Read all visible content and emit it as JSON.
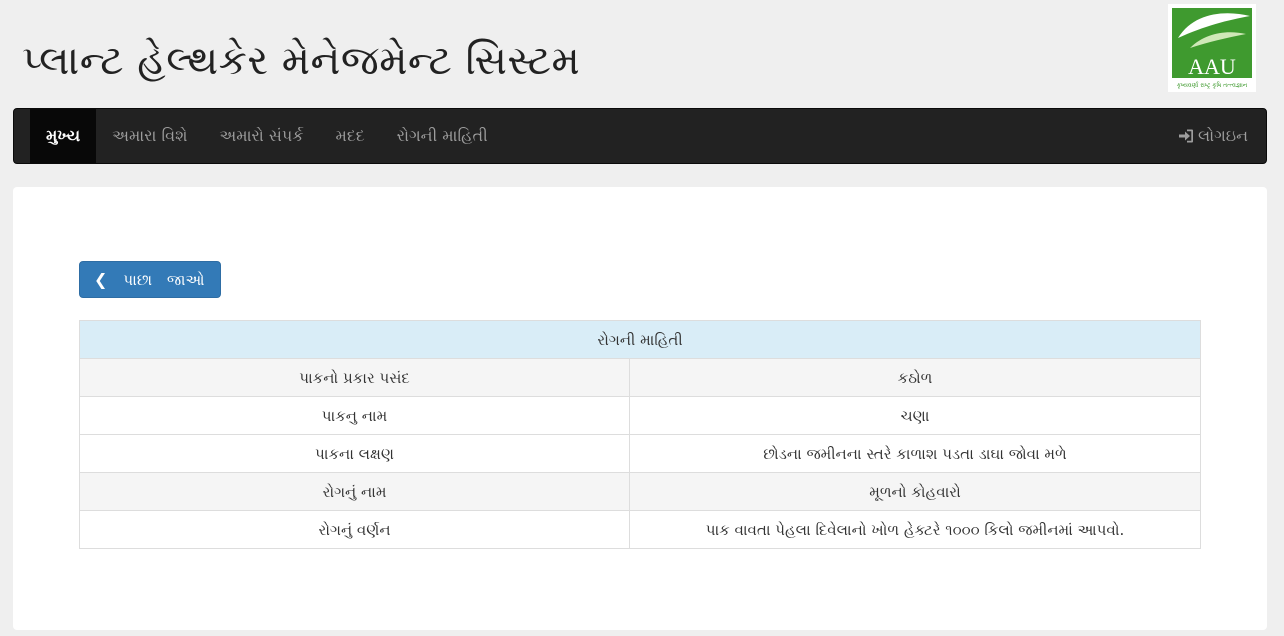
{
  "header": {
    "title": "પ્લાન્ટ હેલ્થકેર મેનેજમેન્ટ સિસ્ટમ",
    "logo": {
      "text": "AAU",
      "tagline": "કૃષ્યવર્ણા રાષ્ટ્ર કૃષિ તત્ત્વજ્ઞાન",
      "icon": "leaf-logo-icon",
      "colors": {
        "green": "#3f9a2f",
        "light": "#8cc63f"
      }
    }
  },
  "navbar": {
    "items": [
      {
        "label": "મુખ્ય",
        "active": true
      },
      {
        "label": "અમારા વિશે"
      },
      {
        "label": "અમારો સંપર્ક"
      },
      {
        "label": "મદદ"
      },
      {
        "label": "રોગની માહિતી"
      }
    ],
    "login": {
      "label": "લોગઇન",
      "icon": "sign-in-icon"
    }
  },
  "main": {
    "back_button": {
      "label": "પાછા જાઓ",
      "icon": "chevron-left-icon"
    },
    "table": {
      "heading": "રોગની માહિતી",
      "rows": [
        {
          "label": "પાકનો પ્રકાર પસંદ",
          "value": "કઠોળ"
        },
        {
          "label": "પાકનુ નામ",
          "value": "ચણા"
        },
        {
          "label": "પાકના લક્ષણ",
          "value": "છોડના જમીનના સ્તરે કાળાશ પડતા ડાઘા જોવા મળે"
        },
        {
          "label": "રોગનું નામ",
          "value": "મૂળનો કોહવારો"
        },
        {
          "label": "રોગનું વર્ણન",
          "value": "પાક વાવતા પેહલા દિવેલાનો ખોળ હેક્ટરે ૧૦૦૦ કિલો જમીનમાં આપવો."
        }
      ]
    }
  },
  "colors": {
    "navbar_bg": "#222222",
    "primary": "#337ab7",
    "table_heading_bg": "#d9edf7"
  }
}
